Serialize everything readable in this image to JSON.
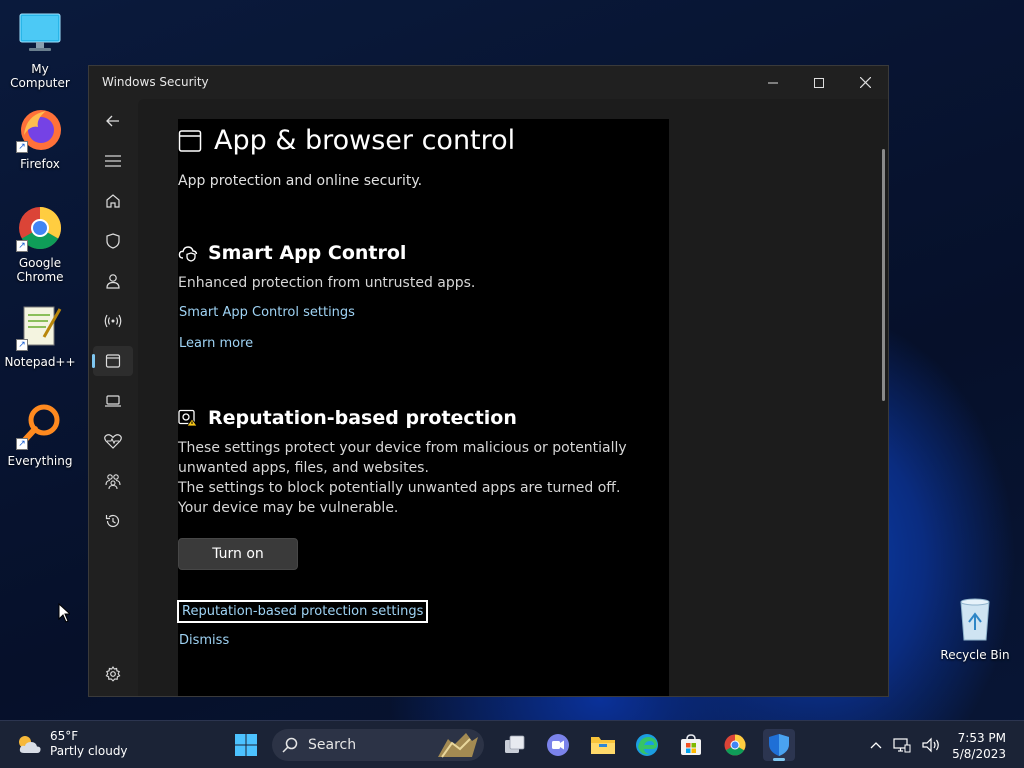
{
  "desktop": {
    "icons": [
      {
        "label": "My Computer",
        "icon": "monitor-icon"
      },
      {
        "label": "Firefox",
        "icon": "firefox-icon"
      },
      {
        "label": "Google Chrome",
        "icon": "chrome-icon"
      },
      {
        "label": "Notepad++",
        "icon": "notepadpp-icon"
      },
      {
        "label": "Everything",
        "icon": "everything-search-icon"
      },
      {
        "label": "Recycle Bin",
        "icon": "recycle-bin-icon"
      }
    ]
  },
  "window": {
    "title": "Windows Security",
    "page_title": "App & browser control",
    "page_subtitle": "App protection and online security.",
    "smart_app": {
      "title": "Smart App Control",
      "description": "Enhanced protection from untrusted apps.",
      "settings_link": "Smart App Control settings",
      "learn_more": "Learn more"
    },
    "reputation": {
      "title": "Reputation-based protection",
      "description_1": "These settings protect your device from malicious or potentially unwanted apps, files, and websites.",
      "description_2": "The settings to block potentially unwanted apps are turned off. Your device may be vulnerable.",
      "turn_on": "Turn on",
      "settings_link": "Reputation-based protection settings",
      "dismiss": "Dismiss"
    }
  },
  "taskbar": {
    "weather_temp": "65°F",
    "weather_desc": "Partly cloudy",
    "search_label": "Search",
    "time": "7:53 PM",
    "date": "5/8/2023"
  },
  "colors": {
    "accent": "#7fc7f0",
    "link": "#9fd3f4"
  }
}
